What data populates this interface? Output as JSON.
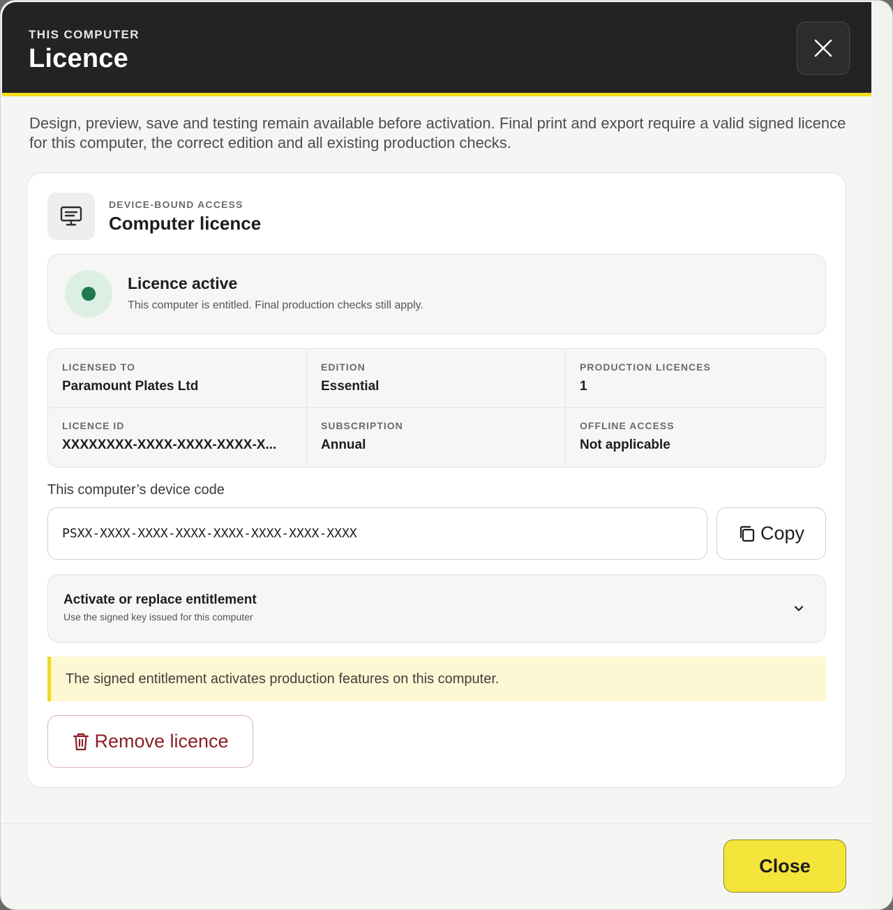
{
  "header": {
    "eyebrow": "THIS COMPUTER",
    "title": "Licence"
  },
  "intro": "Design, preview, save and testing remain available before activation. Final print and export require a valid signed licence for this computer, the correct edition and all existing production checks.",
  "card": {
    "icon": "monitor-icon",
    "eyebrow": "DEVICE-BOUND ACCESS",
    "title": "Computer licence",
    "status": {
      "title": "Licence active",
      "subtitle": "This computer is entitled. Final production checks still apply.",
      "color": "#1f7a4d"
    },
    "details": [
      {
        "label": "LICENSED TO",
        "value": "Paramount Plates Ltd"
      },
      {
        "label": "EDITION",
        "value": "Essential"
      },
      {
        "label": "PRODUCTION LICENCES",
        "value": "1"
      },
      {
        "label": "LICENCE ID",
        "value": "XXXXXXXX-XXXX-XXXX-XXXX-X..."
      },
      {
        "label": "SUBSCRIPTION",
        "value": "Annual"
      },
      {
        "label": "OFFLINE ACCESS",
        "value": "Not applicable"
      }
    ],
    "device_code": {
      "label": "This computer’s device code",
      "value": "PSXX-XXXX-XXXX-XXXX-XXXX-XXXX-XXXX-XXXX",
      "copy_label": "Copy"
    },
    "activate": {
      "title": "Activate or replace entitlement",
      "subtitle": "Use the signed key issued for this computer"
    },
    "notice": "The signed entitlement activates production features on this computer.",
    "remove_label": "Remove licence"
  },
  "footer": {
    "close_label": "Close"
  },
  "colors": {
    "accent": "#f5e53a",
    "header_bg": "#232323",
    "danger": "#8a1f26"
  }
}
